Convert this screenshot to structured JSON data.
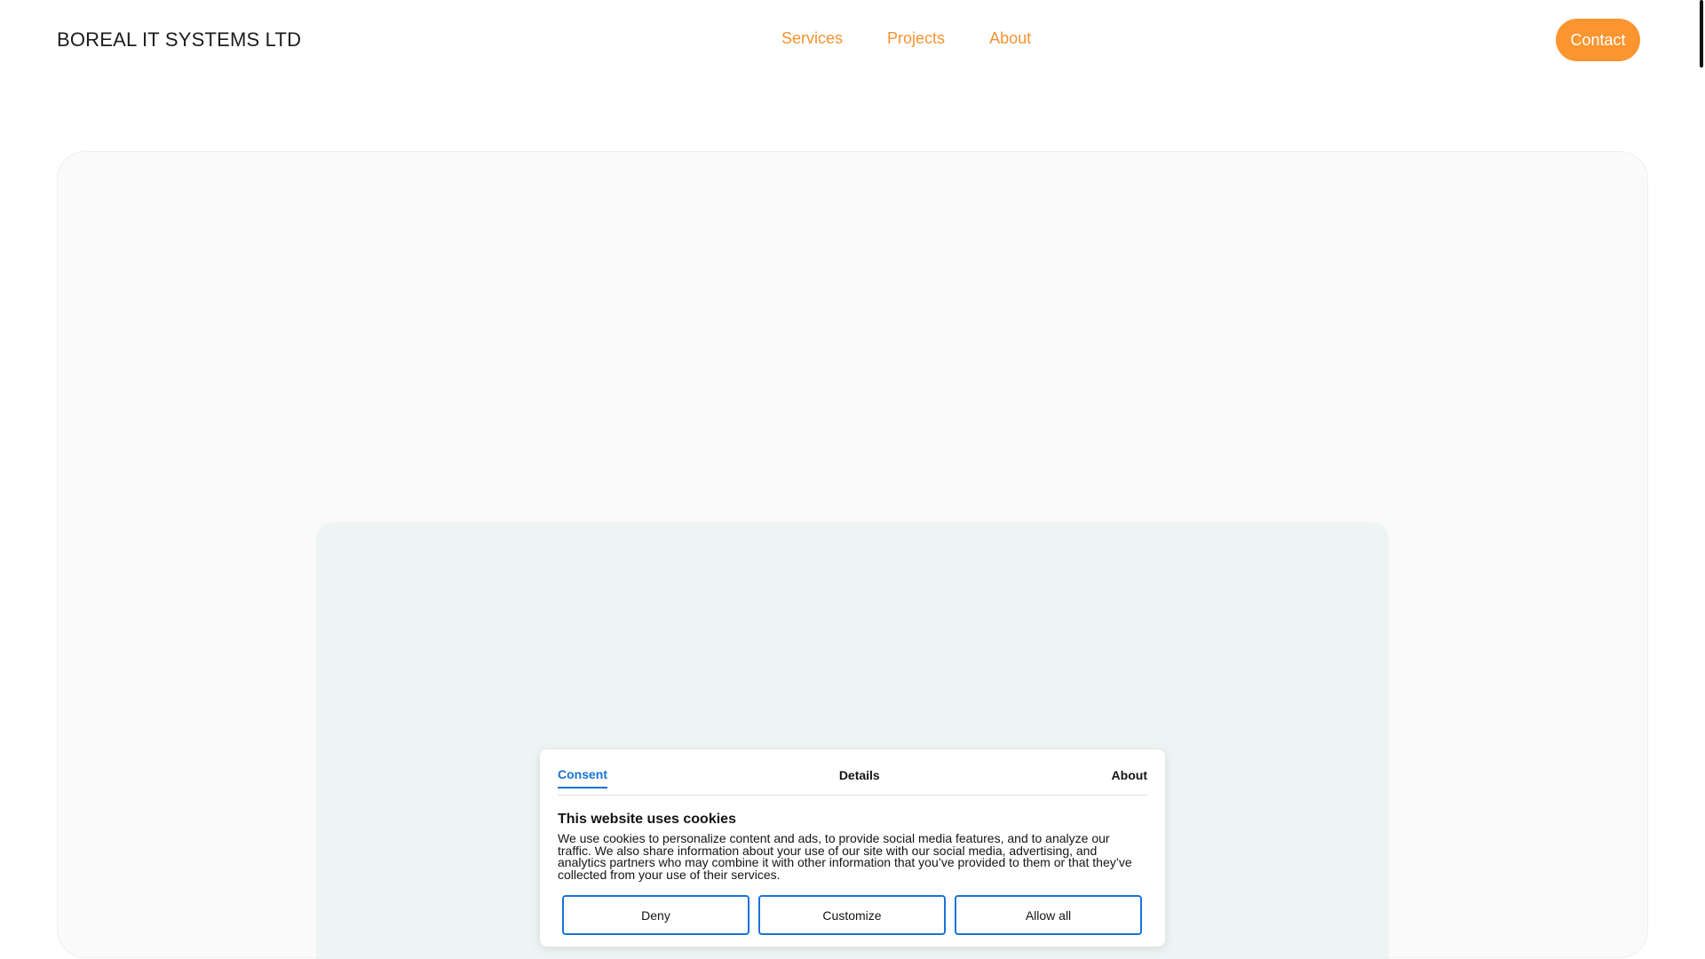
{
  "header": {
    "brand": "BOREAL IT SYSTEMS LTD",
    "nav": [
      "Services",
      "Projects",
      "About"
    ],
    "contact_label": "Contact"
  },
  "colors": {
    "accent": "#fb952f",
    "link": "#f7932f",
    "consent_blue": "#1a73d9"
  },
  "cookie_banner": {
    "tabs": [
      "Consent",
      "Details",
      "About"
    ],
    "active_tab": "Consent",
    "title": "This website uses cookies",
    "text": "We use cookies to personalize content and ads, to provide social media features, and to analyze our traffic. We also share information about your use of our site with our social media, advertising, and analytics partners who may combine it with other information that you’ve provided to them or that they’ve collected from your use of their services.",
    "buttons": {
      "deny": "Deny",
      "customize": "Customize",
      "allow_all": "Allow all"
    }
  }
}
